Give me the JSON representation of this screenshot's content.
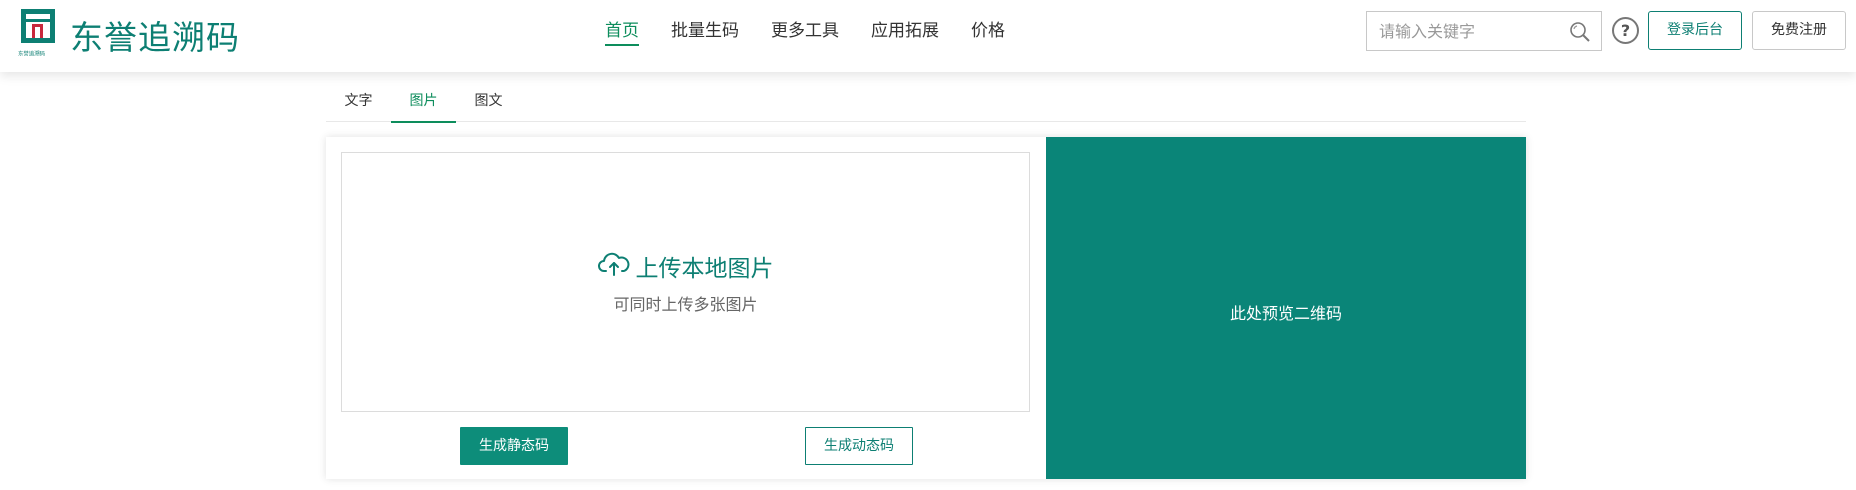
{
  "header": {
    "logo": {
      "brand_name": "东誉追溯码",
      "mark_caption": "东誉追溯码"
    },
    "nav": [
      {
        "label": "首页",
        "active": true
      },
      {
        "label": "批量生码",
        "active": false
      },
      {
        "label": "更多工具",
        "active": false
      },
      {
        "label": "应用拓展",
        "active": false
      },
      {
        "label": "价格",
        "active": false
      }
    ],
    "search": {
      "placeholder": "请输入关键字",
      "value": "",
      "icon": "search-icon"
    },
    "help": {
      "label": "?",
      "icon": "help-icon"
    },
    "login_label": "登录后台",
    "register_label": "免费注册"
  },
  "tabs": [
    {
      "label": "文字",
      "active": false
    },
    {
      "label": "图片",
      "active": true
    },
    {
      "label": "图文",
      "active": false
    }
  ],
  "upload": {
    "icon": "cloud-upload-icon",
    "title": "上传本地图片",
    "subtitle": "可同时上传多张图片"
  },
  "actions": {
    "static_label": "生成静态码",
    "dynamic_label": "生成动态码"
  },
  "preview": {
    "text": "此处预览二维码"
  },
  "colors": {
    "brand": "#0d7f73",
    "nav_active": "#0d8d5c",
    "preview_bg": "#0a8578",
    "logo_red": "#c8283c"
  }
}
